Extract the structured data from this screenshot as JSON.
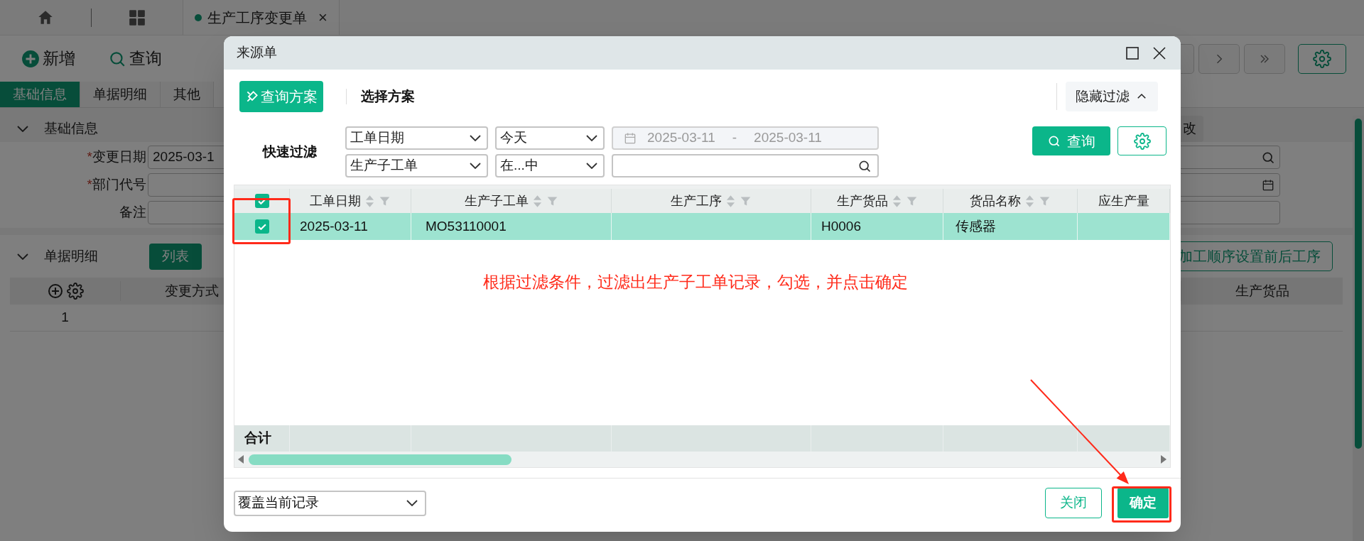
{
  "page": {
    "app_tabs": [
      {
        "label": "生产工序变更单",
        "selected": true,
        "close": "×"
      }
    ],
    "toolbar": [
      {
        "kind": "add",
        "label": "新增"
      },
      {
        "kind": "search",
        "label": "查询"
      }
    ],
    "section_tabs": [
      {
        "label": "基础信息",
        "selected": true
      },
      {
        "label": "单据明细",
        "selected": false
      },
      {
        "label": "其他",
        "selected": false
      }
    ],
    "basic_info": {
      "title": "基础信息",
      "fields": [
        {
          "label": "变更日期",
          "required_mark": "*",
          "value": "2025-03-1"
        },
        {
          "label": "部门代号",
          "required_mark": "*"
        },
        {
          "label": "备注"
        }
      ],
      "edit_button": "改"
    },
    "details": {
      "title": "单据明细",
      "view_button": "列表",
      "action_button": "加工顺序设置前后工序",
      "columns": [
        "变更方式",
        "生产货品"
      ],
      "rows": [
        [
          "1"
        ]
      ]
    }
  },
  "dialog": {
    "title": "来源单",
    "scheme_button": "查询方案",
    "scheme_label": "选择方案",
    "hide_filter": "隐藏过滤",
    "quick_filter": {
      "label": "快速过滤",
      "rows": [
        {
          "kind": "date_range",
          "field": "工单日期",
          "operator": "今天",
          "from": "2025-03-11",
          "separator": "-",
          "to": "2025-03-11"
        },
        {
          "kind": "search",
          "field": "生产子工单",
          "operator": "在...中"
        }
      ]
    },
    "query_button": "查询",
    "table": {
      "all_checked": true,
      "columns": [
        {
          "label": "工单日期",
          "sortable": true
        },
        {
          "label": "生产子工单",
          "sortable": true
        },
        {
          "label": "生产工序",
          "sortable": true
        },
        {
          "label": "生产货品",
          "sortable": true
        },
        {
          "label": "货品名称",
          "sortable": true
        },
        {
          "label": "应生产量",
          "sortable": false
        }
      ],
      "rows": [
        {
          "checked": true,
          "selected": true,
          "cells": [
            "2025-03-11",
            "MO53110001",
            "",
            "H0006",
            "传感器",
            ""
          ]
        }
      ],
      "total_label": "合计"
    },
    "annotation": "根据过滤条件，过滤出生产子工单记录，勾选，并点击确定",
    "footer": {
      "mode": "覆盖当前记录",
      "close_button": "关闭",
      "confirm_button": "确定"
    }
  }
}
